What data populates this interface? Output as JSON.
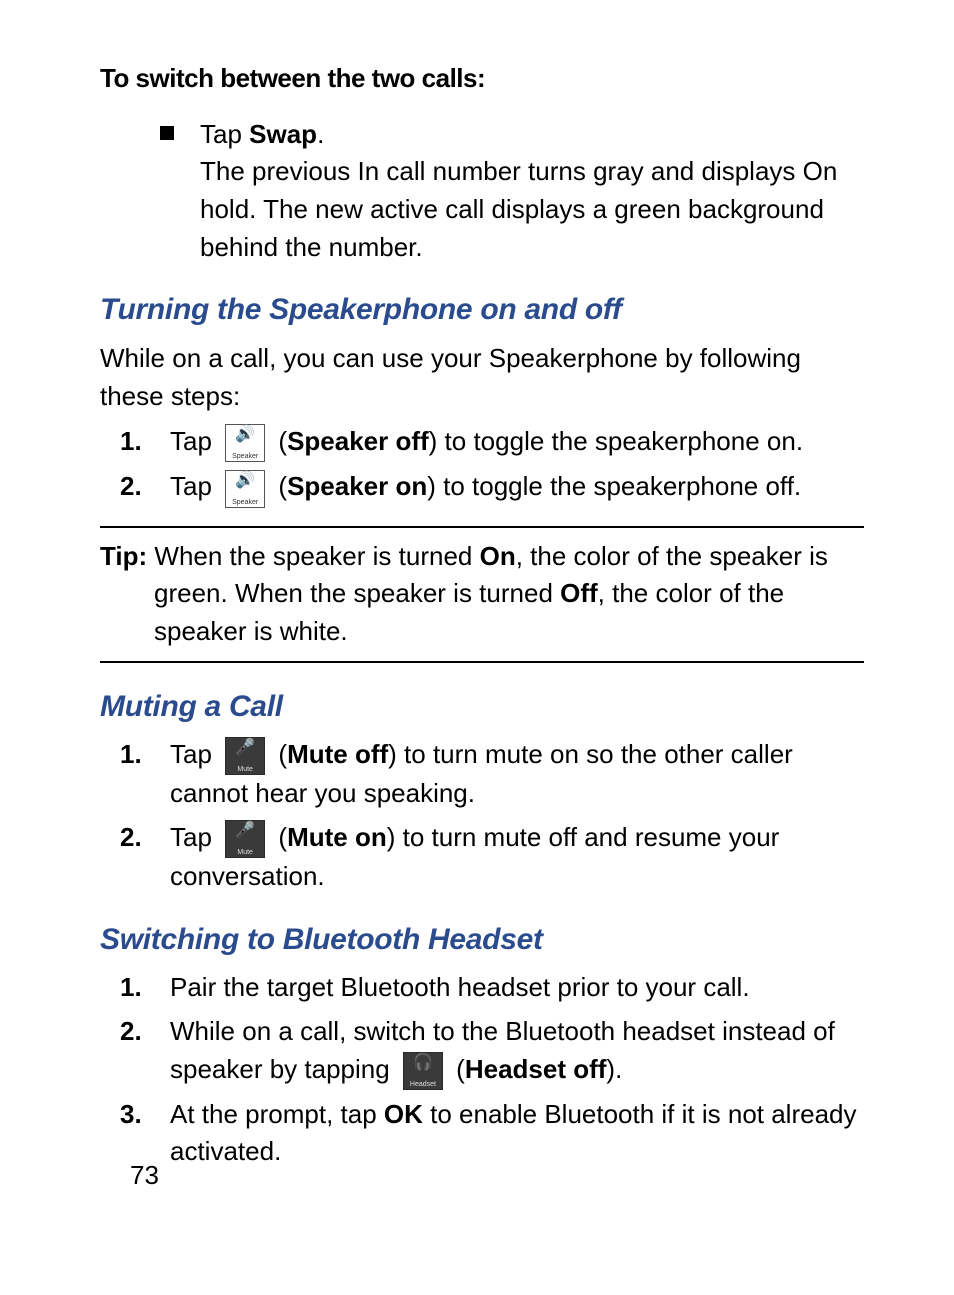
{
  "pageNumber": "73",
  "intro": {
    "heading": "To switch between the two calls:",
    "bullet": {
      "tap": "Tap ",
      "swap": "Swap",
      "period": ".",
      "desc": "The previous In call number turns gray and displays On hold. The new active call displays a green background behind the number."
    }
  },
  "speakerphone": {
    "title": "Turning the Speakerphone on and off",
    "intro": "While on a call, you can use your Speakerphone by following these steps:",
    "step1": {
      "num": "1.",
      "tap": "Tap ",
      "label": "Speaker off",
      "rest": ") to toggle the speakerphone on.",
      "iconLabel": "Speaker"
    },
    "step2": {
      "num": "2.",
      "tap": "Tap ",
      "label": "Speaker on",
      "rest": ") to toggle the speakerphone off.",
      "iconLabel": "Speaker"
    }
  },
  "tip": {
    "label": "Tip:",
    "pre1": " When the speaker is turned ",
    "on": "On",
    "post1": ", the color of the speaker is green. When the speaker is turned ",
    "off": "Off",
    "post2": ", the color of the speaker is white."
  },
  "mute": {
    "title": "Muting a Call",
    "step1": {
      "num": "1.",
      "tap": "Tap ",
      "label": "Mute off",
      "rest": ") to turn mute on so the other caller cannot hear you speaking.",
      "iconLabel": "Mute"
    },
    "step2": {
      "num": "2.",
      "tap": "Tap ",
      "label": "Mute on",
      "rest": ") to turn mute off and resume your conversation.",
      "iconLabel": "Mute"
    }
  },
  "bluetooth": {
    "title": "Switching to Bluetooth Headset",
    "step1": {
      "num": "1.",
      "text": "Pair the target Bluetooth headset prior to your call."
    },
    "step2": {
      "num": "2.",
      "pre": "While on a call, switch to the Bluetooth headset instead of speaker by tapping ",
      "label": "Headset off",
      "rest": ").",
      "iconLabel": "Headset"
    },
    "step3": {
      "num": "3.",
      "pre": "At the prompt, tap ",
      "ok": "OK",
      "rest": " to enable Bluetooth if it is not already activated."
    }
  }
}
